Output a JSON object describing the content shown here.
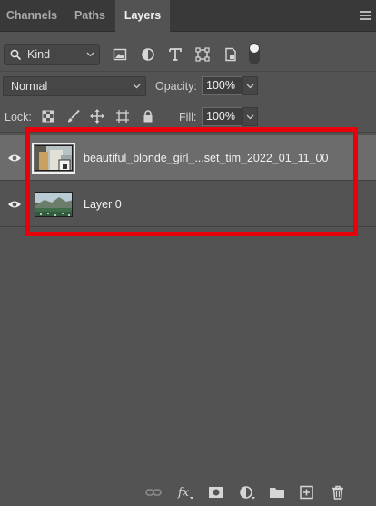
{
  "tabs": [
    {
      "label": "Channels"
    },
    {
      "label": "Paths"
    },
    {
      "label": "Layers"
    }
  ],
  "filter": {
    "kind_label": "Kind",
    "icons": [
      "pixel-filter-icon",
      "adjustment-filter-icon",
      "type-filter-icon",
      "shape-filter-icon",
      "smart-object-filter-icon",
      "filter-toggle"
    ]
  },
  "blend": {
    "mode": "Normal",
    "opacity_label": "Opacity:",
    "opacity_value": "100%"
  },
  "lock": {
    "label": "Lock:",
    "fill_label": "Fill:",
    "fill_value": "100%"
  },
  "layers": [
    {
      "name": "beautiful_blonde_girl_...set_tim_2022_01_11_00",
      "selected": true,
      "smart_object": true,
      "visible": true
    },
    {
      "name": "Layer 0",
      "selected": false,
      "smart_object": false,
      "visible": true
    }
  ],
  "colors": {
    "panel_bg": "#535353",
    "selected_row": "#6c6c6c",
    "highlight": "#e8000b"
  }
}
